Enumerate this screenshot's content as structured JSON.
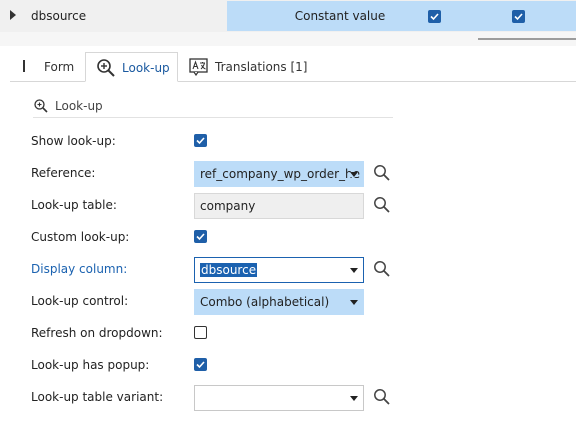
{
  "grid": {
    "row_name": "dbsource",
    "constant_value": "Constant value",
    "checkbox1_checked": true,
    "checkbox2_checked": true
  },
  "tabs": [
    {
      "label": "Form",
      "icon": "form-icon"
    },
    {
      "label": "Look-up",
      "icon": "magnifier-plus-icon",
      "active": true
    },
    {
      "label": "Translations [1]",
      "icon": "translate-icon"
    }
  ],
  "section": {
    "title": "Look-up",
    "icon": "magnifier-plus-icon"
  },
  "fields": {
    "show_lookup": {
      "label": "Show look-up:",
      "checked": true
    },
    "reference": {
      "label": "Reference:",
      "value": "ref_company_wp_order_he"
    },
    "lookup_table": {
      "label": "Look-up table:",
      "value": "company"
    },
    "custom_lookup": {
      "label": "Custom look-up:",
      "checked": true
    },
    "display_column": {
      "label": "Display column:",
      "value": "dbsource"
    },
    "lookup_control": {
      "label": "Look-up control:",
      "value": "Combo (alphabetical)"
    },
    "refresh_on_dropdown": {
      "label": "Refresh on dropdown:",
      "checked": false
    },
    "lookup_has_popup": {
      "label": "Look-up has popup:",
      "checked": true
    },
    "lookup_table_variant": {
      "label": "Look-up table variant:",
      "value": ""
    }
  },
  "colors": {
    "accent": "#1b62b0",
    "selection": "#bcdcf8",
    "checkbox": "#1f5fa8"
  }
}
